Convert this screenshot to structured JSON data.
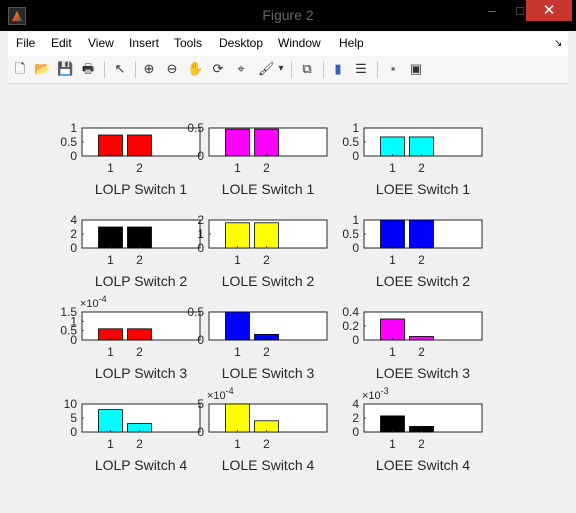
{
  "window": {
    "title": "Figure 2",
    "minimize": "–",
    "maximize": "□",
    "close": "✕",
    "icon": "matlab-icon"
  },
  "menu": [
    "File",
    "Edit",
    "View",
    "Insert",
    "Tools",
    "Desktop",
    "Window",
    "Help"
  ],
  "dock_glyph": "↘",
  "toolbar": [
    {
      "name": "new-figure-icon",
      "glyph": "🗋"
    },
    {
      "name": "open-file-icon",
      "glyph": "📂"
    },
    {
      "name": "save-icon",
      "glyph": "💾"
    },
    {
      "name": "print-icon",
      "glyph": "🖶"
    },
    {
      "name": "edit-plot-arrow-icon",
      "glyph": "↖"
    },
    {
      "name": "zoom-in-icon",
      "glyph": "⊕"
    },
    {
      "name": "zoom-out-icon",
      "glyph": "⊖"
    },
    {
      "name": "pan-icon",
      "glyph": "✋"
    },
    {
      "name": "rotate-3d-icon",
      "glyph": "⟳"
    },
    {
      "name": "data-cursor-icon",
      "glyph": "⌖"
    },
    {
      "name": "brush-icon",
      "glyph": "🖌"
    },
    {
      "name": "brush-dropdown-icon",
      "glyph": "▾"
    },
    {
      "name": "link-plot-icon",
      "glyph": "⧉"
    },
    {
      "name": "insert-colorbar-icon",
      "glyph": "▮"
    },
    {
      "name": "insert-legend-icon",
      "glyph": "☰"
    },
    {
      "name": "hide-plot-tools-icon",
      "glyph": "▪"
    },
    {
      "name": "show-plot-tools-icon",
      "glyph": "▣"
    }
  ],
  "colors": {
    "red": "#ff0000",
    "magenta": "#ff00ff",
    "cyan": "#00ffff",
    "black": "#000000",
    "yellow": "#ffff00",
    "blue": "#0000ff"
  },
  "chart_data": [
    {
      "type": "bar",
      "title": "LOLP Switch 1",
      "categories": [
        "1",
        "2"
      ],
      "values": [
        0.75,
        0.75
      ],
      "color": "#ff0000",
      "ylim": [
        0,
        1
      ],
      "yticks": [
        "0",
        "0.5",
        "1"
      ],
      "ytick_values": [
        0,
        0.5,
        1
      ],
      "exponent": ""
    },
    {
      "type": "bar",
      "title": "LOLE Switch 1",
      "categories": [
        "1",
        "2"
      ],
      "values": [
        0.48,
        0.48
      ],
      "color": "#ff00ff",
      "ylim": [
        0,
        0.5
      ],
      "yticks": [
        "0",
        "0.5"
      ],
      "ytick_values": [
        0,
        0.5
      ],
      "exponent": ""
    },
    {
      "type": "bar",
      "title": "LOEE Switch 1",
      "categories": [
        "1",
        "2"
      ],
      "values": [
        0.68,
        0.68
      ],
      "color": "#00ffff",
      "ylim": [
        0,
        1
      ],
      "yticks": [
        "0",
        "0.5",
        "1"
      ],
      "ytick_values": [
        0,
        0.5,
        1
      ],
      "exponent": ""
    },
    {
      "type": "bar",
      "title": "LOLP Switch 2",
      "categories": [
        "1",
        "2"
      ],
      "values": [
        3,
        3
      ],
      "color": "#000000",
      "ylim": [
        0,
        4
      ],
      "yticks": [
        "0",
        "2",
        "4"
      ],
      "ytick_values": [
        0,
        2,
        4
      ],
      "exponent": ""
    },
    {
      "type": "bar",
      "title": "LOLE Switch 2",
      "categories": [
        "1",
        "2"
      ],
      "values": [
        1.8,
        1.8
      ],
      "color": "#ffff00",
      "ylim": [
        0,
        2
      ],
      "yticks": [
        "0",
        "1",
        "2"
      ],
      "ytick_values": [
        0,
        1,
        2
      ],
      "exponent": ""
    },
    {
      "type": "bar",
      "title": "LOEE  Switch 2",
      "categories": [
        "1",
        "2"
      ],
      "values": [
        1,
        1
      ],
      "color": "#0000ff",
      "ylim": [
        0,
        1
      ],
      "yticks": [
        "0",
        "0.5",
        "1"
      ],
      "ytick_values": [
        0,
        0.5,
        1
      ],
      "exponent": ""
    },
    {
      "type": "bar",
      "title": "LOLP Switch 3",
      "categories": [
        "1",
        "2"
      ],
      "values": [
        0.6,
        0.6
      ],
      "color": "#ff0000",
      "ylim": [
        0,
        1.5
      ],
      "yticks": [
        "0",
        "0.5",
        "1",
        "1.5"
      ],
      "ytick_values": [
        0,
        0.5,
        1,
        1.5
      ],
      "exponent": "-4"
    },
    {
      "type": "bar",
      "title": "LOLE Switch 3",
      "categories": [
        "1",
        "2"
      ],
      "values": [
        0.5,
        0.1
      ],
      "color": "#0000ff",
      "ylim": [
        0,
        0.5
      ],
      "yticks": [
        "0",
        "0.5"
      ],
      "ytick_values": [
        0,
        0.5
      ],
      "exponent": ""
    },
    {
      "type": "bar",
      "title": "LOEE Switch 3",
      "categories": [
        "1",
        "2"
      ],
      "values": [
        0.3,
        0.05
      ],
      "color": "#ff00ff",
      "ylim": [
        0,
        0.4
      ],
      "yticks": [
        "0",
        "0.2",
        "0.4"
      ],
      "ytick_values": [
        0,
        0.2,
        0.4
      ],
      "exponent": ""
    },
    {
      "type": "bar",
      "title": "LOLP Switch 4",
      "categories": [
        "1",
        "2"
      ],
      "values": [
        8,
        3
      ],
      "color": "#00ffff",
      "ylim": [
        0,
        10
      ],
      "yticks": [
        "0",
        "5",
        "10"
      ],
      "ytick_values": [
        0,
        5,
        10
      ],
      "exponent": ""
    },
    {
      "type": "bar",
      "title": "LOLE Switch 4",
      "categories": [
        "1",
        "2"
      ],
      "values": [
        5,
        2
      ],
      "color": "#ffff00",
      "ylim": [
        0,
        5
      ],
      "yticks": [
        "0",
        "5"
      ],
      "ytick_values": [
        0,
        5
      ],
      "exponent": "-4"
    },
    {
      "type": "bar",
      "title": "LOEE Switch 4",
      "categories": [
        "1",
        "2"
      ],
      "values": [
        2.3,
        0.8
      ],
      "color": "#000000",
      "ylim": [
        0,
        4
      ],
      "yticks": [
        "0",
        "2",
        "4"
      ],
      "ytick_values": [
        0,
        2,
        4
      ],
      "exponent": "-3"
    }
  ]
}
